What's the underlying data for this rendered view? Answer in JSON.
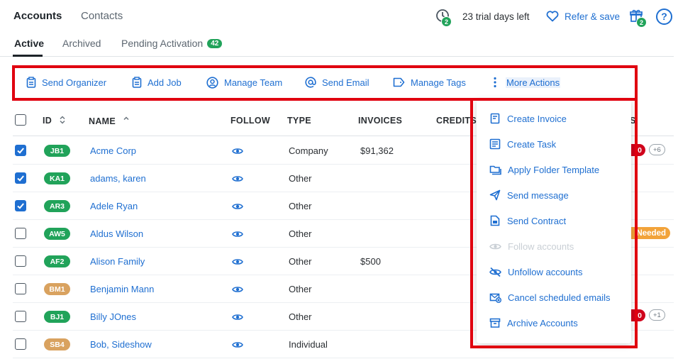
{
  "nav": {
    "accounts": "Accounts",
    "contacts": "Contacts"
  },
  "header": {
    "trial_badge": "2",
    "trial_text": "23 trial days left",
    "refer": "Refer & save",
    "gift_badge": "2",
    "help": "?"
  },
  "tabs": [
    {
      "label": "Active"
    },
    {
      "label": "Archived"
    },
    {
      "label": "Pending Activation",
      "count": "42"
    }
  ],
  "toolbar": {
    "send_organizer": "Send Organizer",
    "add_job": "Add Job",
    "manage_team": "Manage Team",
    "send_email": "Send Email",
    "manage_tags": "Manage Tags",
    "more_actions": "More Actions"
  },
  "table": {
    "headers": {
      "id": "ID",
      "name": "NAME",
      "follow": "FOLLOW",
      "type": "TYPE",
      "invoices": "INVOICES",
      "credits": "CREDITS",
      "tags_partial": "S"
    },
    "rows": [
      {
        "checked": true,
        "id": "JB1",
        "id_color": "#21a35a",
        "name": "Acme Corp",
        "type": "Company",
        "invoice": "$91,362"
      },
      {
        "checked": true,
        "id": "KA1",
        "id_color": "#21a35a",
        "name": "adams, karen",
        "type": "Other",
        "invoice": ""
      },
      {
        "checked": true,
        "id": "AR3",
        "id_color": "#21a35a",
        "name": "Adele Ryan",
        "type": "Other",
        "invoice": ""
      },
      {
        "checked": false,
        "id": "AW5",
        "id_color": "#21a35a",
        "name": "Aldus Wilson",
        "type": "Other",
        "invoice": ""
      },
      {
        "checked": false,
        "id": "AF2",
        "id_color": "#21a35a",
        "name": "Alison Family",
        "type": "Other",
        "invoice": "$500"
      },
      {
        "checked": false,
        "id": "BM1",
        "id_color": "#d9a25f",
        "name": "Benjamin Mann",
        "type": "Other",
        "invoice": ""
      },
      {
        "checked": false,
        "id": "BJ1",
        "id_color": "#21a35a",
        "name": "Billy JOnes",
        "type": "Other",
        "invoice": ""
      },
      {
        "checked": false,
        "id": "SB4",
        "id_color": "#d9a25f",
        "name": "Bob, Sideshow",
        "type": "Individual",
        "invoice": ""
      }
    ],
    "tag_row1_red": "0",
    "tag_row1_more": "+6",
    "tag_row4_orange": "Needed",
    "tag_row7_red": "0",
    "tag_row7_more": "+1"
  },
  "menu": {
    "items": [
      {
        "label": "Create Invoice",
        "icon": "invoice-icon",
        "enabled": true
      },
      {
        "label": "Create Task",
        "icon": "task-icon",
        "enabled": true
      },
      {
        "label": "Apply Folder Template",
        "icon": "folders-icon",
        "enabled": true
      },
      {
        "label": "Send message",
        "icon": "send-icon",
        "enabled": true
      },
      {
        "label": "Send Contract",
        "icon": "contract-icon",
        "enabled": true
      },
      {
        "label": "Follow accounts",
        "icon": "eye-icon",
        "enabled": false
      },
      {
        "label": "Unfollow accounts",
        "icon": "eye-off-icon",
        "enabled": true
      },
      {
        "label": "Cancel scheduled emails",
        "icon": "mail-cancel-icon",
        "enabled": true
      },
      {
        "label": "Archive Accounts",
        "icon": "archive-icon",
        "enabled": true
      }
    ]
  },
  "colors": {
    "accent": "#1f6fd1",
    "success": "#21a35a",
    "highlight": "#e0000f"
  }
}
